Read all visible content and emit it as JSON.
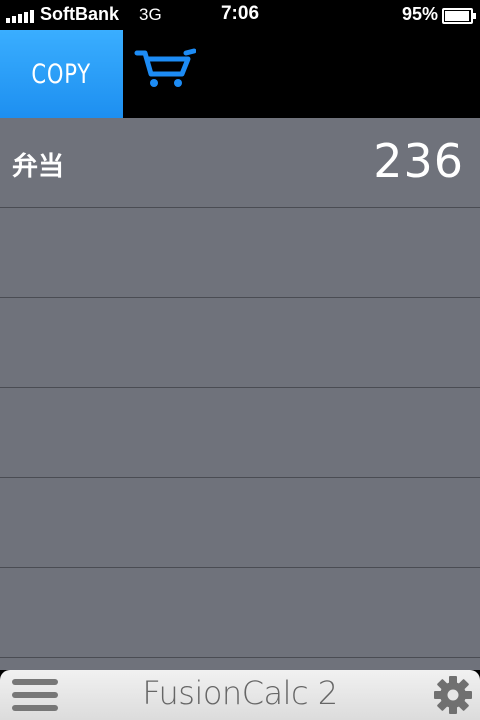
{
  "status_bar": {
    "carrier": "SoftBank",
    "network": "3G",
    "time": "7:06",
    "battery_percent": "95%",
    "battery_level": 0.95
  },
  "toolbar": {
    "copy_label": "COPY",
    "cart_icon": "cart-icon",
    "accent_color": "#1d9bff"
  },
  "list": {
    "rows": [
      {
        "label": "弁当",
        "value": "236"
      },
      {
        "label": "",
        "value": ""
      },
      {
        "label": "",
        "value": ""
      },
      {
        "label": "",
        "value": ""
      },
      {
        "label": "",
        "value": ""
      },
      {
        "label": "",
        "value": ""
      }
    ]
  },
  "bottom_bar": {
    "menu_icon": "hamburger-menu-icon",
    "app_title": "FusionCalc 2",
    "settings_icon": "gear-icon"
  }
}
